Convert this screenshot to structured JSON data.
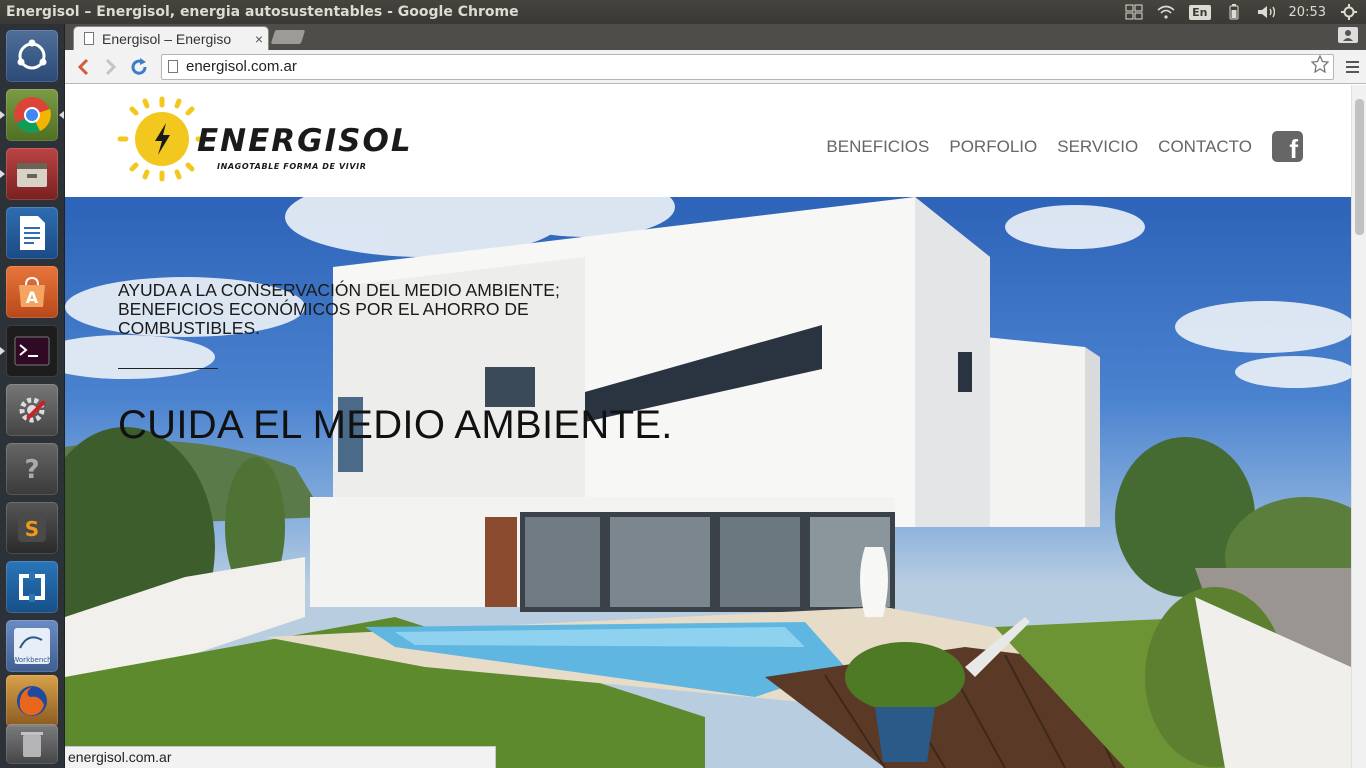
{
  "os": {
    "window_title": "Energisol – Energisol, energia autosustentables - Google Chrome",
    "keyboard_layout": "En",
    "clock": "20:53"
  },
  "browser": {
    "tab_title": "Energisol – Energiso",
    "tab_close": "×",
    "url": "energisol.com.ar",
    "status_url": "energisol.com.ar"
  },
  "site": {
    "logo_word": "ENERGISOL",
    "logo_tagline": "INAGOTABLE FORMA DE VIVIR",
    "nav": [
      "BENEFICIOS",
      "PORFOLIO",
      "SERVICIO",
      "CONTACTO"
    ],
    "facebook_glyph": "f",
    "hero_subtitle": "AYUDA A LA CONSERVACIÓN DEL MEDIO AMBIENTE; BENEFICIOS ECONÓMICOS POR EL AHORRO DE COMBUSTIBLES.",
    "hero_title": "CUIDA EL MEDIO AMBIENTE."
  },
  "colors": {
    "logo_yellow": "#f2c81e",
    "nav_gray": "#666666",
    "panel_bg": "#3c3b37"
  }
}
